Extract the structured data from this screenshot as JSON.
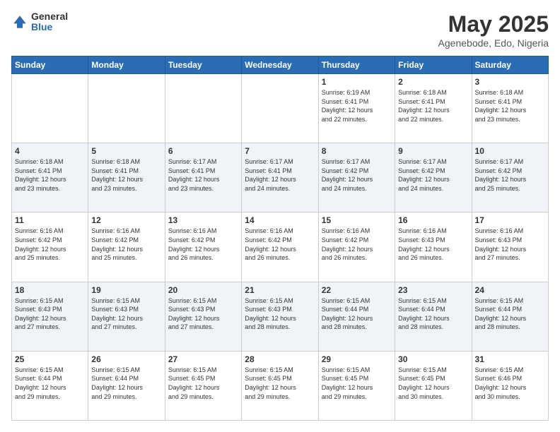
{
  "logo": {
    "general": "General",
    "blue": "Blue"
  },
  "title": "May 2025",
  "subtitle": "Agenebode, Edo, Nigeria",
  "days": [
    "Sunday",
    "Monday",
    "Tuesday",
    "Wednesday",
    "Thursday",
    "Friday",
    "Saturday"
  ],
  "weeks": [
    [
      {
        "num": "",
        "info": ""
      },
      {
        "num": "",
        "info": ""
      },
      {
        "num": "",
        "info": ""
      },
      {
        "num": "",
        "info": ""
      },
      {
        "num": "1",
        "info": "Sunrise: 6:19 AM\nSunset: 6:41 PM\nDaylight: 12 hours\nand 22 minutes."
      },
      {
        "num": "2",
        "info": "Sunrise: 6:18 AM\nSunset: 6:41 PM\nDaylight: 12 hours\nand 22 minutes."
      },
      {
        "num": "3",
        "info": "Sunrise: 6:18 AM\nSunset: 6:41 PM\nDaylight: 12 hours\nand 23 minutes."
      }
    ],
    [
      {
        "num": "4",
        "info": "Sunrise: 6:18 AM\nSunset: 6:41 PM\nDaylight: 12 hours\nand 23 minutes."
      },
      {
        "num": "5",
        "info": "Sunrise: 6:18 AM\nSunset: 6:41 PM\nDaylight: 12 hours\nand 23 minutes."
      },
      {
        "num": "6",
        "info": "Sunrise: 6:17 AM\nSunset: 6:41 PM\nDaylight: 12 hours\nand 23 minutes."
      },
      {
        "num": "7",
        "info": "Sunrise: 6:17 AM\nSunset: 6:41 PM\nDaylight: 12 hours\nand 24 minutes."
      },
      {
        "num": "8",
        "info": "Sunrise: 6:17 AM\nSunset: 6:42 PM\nDaylight: 12 hours\nand 24 minutes."
      },
      {
        "num": "9",
        "info": "Sunrise: 6:17 AM\nSunset: 6:42 PM\nDaylight: 12 hours\nand 24 minutes."
      },
      {
        "num": "10",
        "info": "Sunrise: 6:17 AM\nSunset: 6:42 PM\nDaylight: 12 hours\nand 25 minutes."
      }
    ],
    [
      {
        "num": "11",
        "info": "Sunrise: 6:16 AM\nSunset: 6:42 PM\nDaylight: 12 hours\nand 25 minutes."
      },
      {
        "num": "12",
        "info": "Sunrise: 6:16 AM\nSunset: 6:42 PM\nDaylight: 12 hours\nand 25 minutes."
      },
      {
        "num": "13",
        "info": "Sunrise: 6:16 AM\nSunset: 6:42 PM\nDaylight: 12 hours\nand 26 minutes."
      },
      {
        "num": "14",
        "info": "Sunrise: 6:16 AM\nSunset: 6:42 PM\nDaylight: 12 hours\nand 26 minutes."
      },
      {
        "num": "15",
        "info": "Sunrise: 6:16 AM\nSunset: 6:42 PM\nDaylight: 12 hours\nand 26 minutes."
      },
      {
        "num": "16",
        "info": "Sunrise: 6:16 AM\nSunset: 6:43 PM\nDaylight: 12 hours\nand 26 minutes."
      },
      {
        "num": "17",
        "info": "Sunrise: 6:16 AM\nSunset: 6:43 PM\nDaylight: 12 hours\nand 27 minutes."
      }
    ],
    [
      {
        "num": "18",
        "info": "Sunrise: 6:15 AM\nSunset: 6:43 PM\nDaylight: 12 hours\nand 27 minutes."
      },
      {
        "num": "19",
        "info": "Sunrise: 6:15 AM\nSunset: 6:43 PM\nDaylight: 12 hours\nand 27 minutes."
      },
      {
        "num": "20",
        "info": "Sunrise: 6:15 AM\nSunset: 6:43 PM\nDaylight: 12 hours\nand 27 minutes."
      },
      {
        "num": "21",
        "info": "Sunrise: 6:15 AM\nSunset: 6:43 PM\nDaylight: 12 hours\nand 28 minutes."
      },
      {
        "num": "22",
        "info": "Sunrise: 6:15 AM\nSunset: 6:44 PM\nDaylight: 12 hours\nand 28 minutes."
      },
      {
        "num": "23",
        "info": "Sunrise: 6:15 AM\nSunset: 6:44 PM\nDaylight: 12 hours\nand 28 minutes."
      },
      {
        "num": "24",
        "info": "Sunrise: 6:15 AM\nSunset: 6:44 PM\nDaylight: 12 hours\nand 28 minutes."
      }
    ],
    [
      {
        "num": "25",
        "info": "Sunrise: 6:15 AM\nSunset: 6:44 PM\nDaylight: 12 hours\nand 29 minutes."
      },
      {
        "num": "26",
        "info": "Sunrise: 6:15 AM\nSunset: 6:44 PM\nDaylight: 12 hours\nand 29 minutes."
      },
      {
        "num": "27",
        "info": "Sunrise: 6:15 AM\nSunset: 6:45 PM\nDaylight: 12 hours\nand 29 minutes."
      },
      {
        "num": "28",
        "info": "Sunrise: 6:15 AM\nSunset: 6:45 PM\nDaylight: 12 hours\nand 29 minutes."
      },
      {
        "num": "29",
        "info": "Sunrise: 6:15 AM\nSunset: 6:45 PM\nDaylight: 12 hours\nand 29 minutes."
      },
      {
        "num": "30",
        "info": "Sunrise: 6:15 AM\nSunset: 6:45 PM\nDaylight: 12 hours\nand 30 minutes."
      },
      {
        "num": "31",
        "info": "Sunrise: 6:15 AM\nSunset: 6:46 PM\nDaylight: 12 hours\nand 30 minutes."
      }
    ]
  ]
}
